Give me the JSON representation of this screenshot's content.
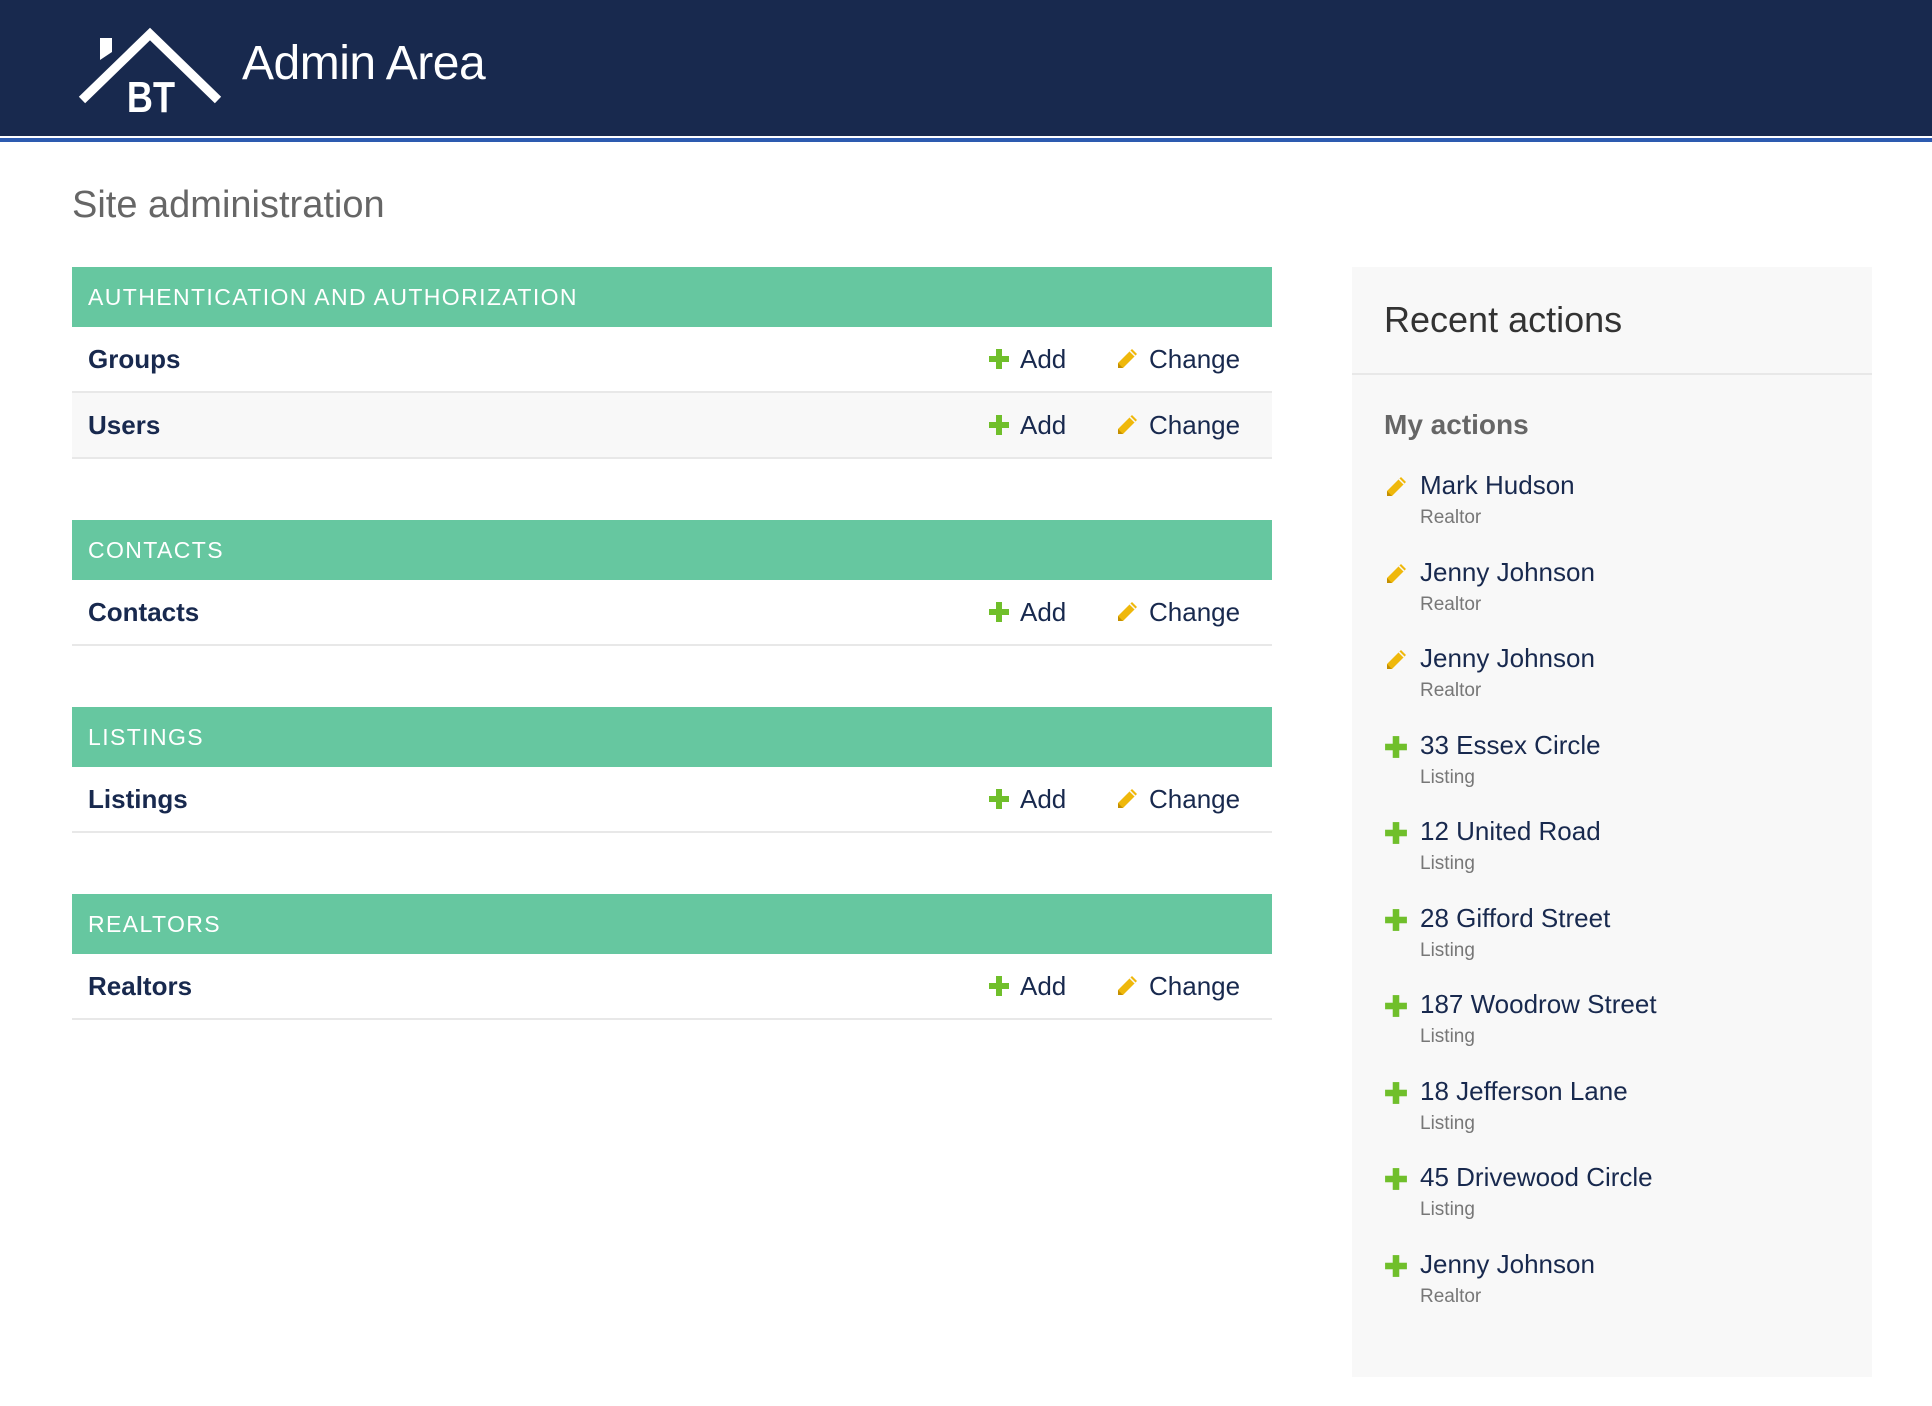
{
  "colors": {
    "header_bg": "#18294e",
    "header_rule": "#2d5bb0",
    "caption_bg": "#66c7a0",
    "link": "#18294e",
    "add_icon": "#70bf2b",
    "change_icon": "#efb80b",
    "sidebar_bg": "#f8f8f8"
  },
  "header": {
    "logo_letters": "BT",
    "title": "Admin Area"
  },
  "page": {
    "title": "Site administration"
  },
  "modules": [
    {
      "caption": "AUTHENTICATION AND AUTHORIZATION",
      "models": [
        {
          "name": "Groups",
          "add_label": "Add",
          "change_label": "Change"
        },
        {
          "name": "Users",
          "add_label": "Add",
          "change_label": "Change"
        }
      ]
    },
    {
      "caption": "CONTACTS",
      "models": [
        {
          "name": "Contacts",
          "add_label": "Add",
          "change_label": "Change"
        }
      ]
    },
    {
      "caption": "LISTINGS",
      "models": [
        {
          "name": "Listings",
          "add_label": "Add",
          "change_label": "Change"
        }
      ]
    },
    {
      "caption": "REALTORS",
      "models": [
        {
          "name": "Realtors",
          "add_label": "Add",
          "change_label": "Change"
        }
      ]
    }
  ],
  "recent_actions": {
    "title": "Recent actions",
    "subtitle": "My actions",
    "items": [
      {
        "icon": "pencil-icon",
        "title": "Mark Hudson",
        "type": "Realtor"
      },
      {
        "icon": "pencil-icon",
        "title": "Jenny Johnson",
        "type": "Realtor"
      },
      {
        "icon": "pencil-icon",
        "title": "Jenny Johnson",
        "type": "Realtor"
      },
      {
        "icon": "plus-icon",
        "title": "33 Essex Circle",
        "type": "Listing"
      },
      {
        "icon": "plus-icon",
        "title": "12 United Road",
        "type": "Listing"
      },
      {
        "icon": "plus-icon",
        "title": "28 Gifford Street",
        "type": "Listing"
      },
      {
        "icon": "plus-icon",
        "title": "187 Woodrow Street",
        "type": "Listing"
      },
      {
        "icon": "plus-icon",
        "title": "18 Jefferson Lane",
        "type": "Listing"
      },
      {
        "icon": "plus-icon",
        "title": "45 Drivewood Circle",
        "type": "Listing"
      },
      {
        "icon": "plus-icon",
        "title": "Jenny Johnson",
        "type": "Realtor"
      }
    ]
  }
}
